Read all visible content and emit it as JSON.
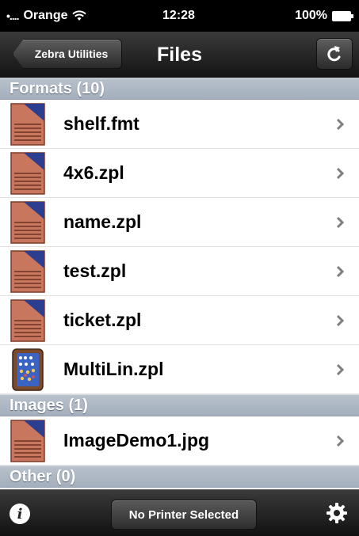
{
  "status_bar": {
    "signal": "•....",
    "carrier": "Orange",
    "time": "12:28",
    "battery": "100%"
  },
  "nav": {
    "back_label": "Zebra Utilities",
    "title": "Files",
    "refresh_icon": "refresh-icon"
  },
  "sections": [
    {
      "header": "Formats  (10)",
      "items": [
        {
          "name": "shelf.fmt",
          "icon": "document-icon"
        },
        {
          "name": "4x6.zpl",
          "icon": "document-icon"
        },
        {
          "name": "name.zpl",
          "icon": "document-icon"
        },
        {
          "name": "test.zpl",
          "icon": "document-icon"
        },
        {
          "name": "ticket.zpl",
          "icon": "document-icon"
        },
        {
          "name": "MultiLin.zpl",
          "icon": "label-preview-icon"
        }
      ]
    },
    {
      "header": "Images  (1)",
      "items": [
        {
          "name": "ImageDemo1.jpg",
          "icon": "document-icon"
        }
      ]
    },
    {
      "header": "Other  (0)",
      "items": []
    }
  ],
  "toolbar": {
    "info_label": "i",
    "printer_label": "No Printer Selected",
    "settings_icon": "gear-icon"
  },
  "colors": {
    "section_header": "#a9b4c1",
    "doc_icon_page": "#c8765e",
    "doc_icon_corner": "#2c3e8f"
  }
}
